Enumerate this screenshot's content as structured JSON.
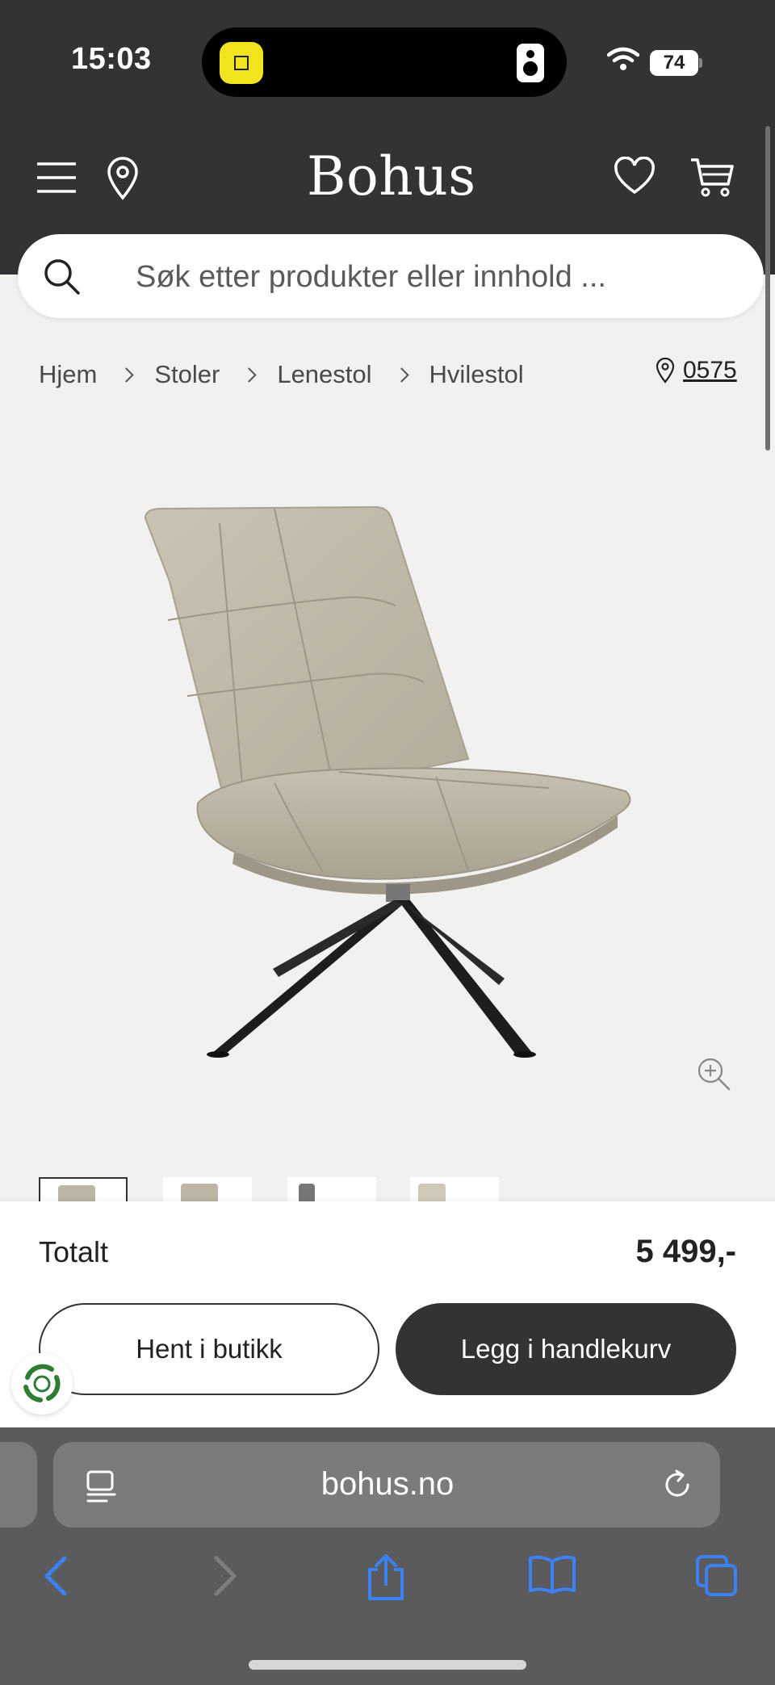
{
  "status_bar": {
    "time": "15:03",
    "battery": "74"
  },
  "header": {
    "brand": "Bohus"
  },
  "search": {
    "placeholder": "Søk etter produkter eller innhold ..."
  },
  "breadcrumb": {
    "items": [
      "Hjem",
      "Stoler",
      "Lenestol",
      "Hvilestol"
    ]
  },
  "store": {
    "postcode": "0575"
  },
  "thumbnails_count": 4,
  "purchase": {
    "total_label": "Totalt",
    "total_price": "5 499,-",
    "pickup_label": "Hent i butikk",
    "add_to_cart_label": "Legg i handlekurv"
  },
  "browser": {
    "url": "bohus.no"
  },
  "colors": {
    "header_bg": "#333235",
    "page_bg": "#f3f1ef",
    "primary_button": "#333235",
    "safari_blue": "#3b82f6"
  }
}
